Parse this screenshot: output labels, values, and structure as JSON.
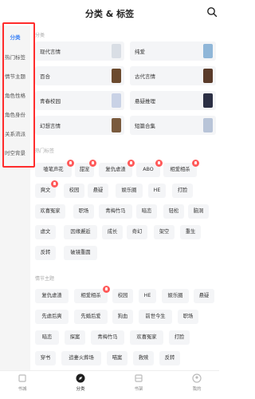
{
  "header": {
    "title": "分类 & 标签"
  },
  "sidebar": {
    "items": [
      "分类",
      "热门标签",
      "情节主题",
      "角色性格",
      "角色身份",
      "关系流派",
      "时空背景"
    ]
  },
  "sections": {
    "category": "分类",
    "hot_tags": "热门标签",
    "plot": "情节主题"
  },
  "categories": [
    "现代言情",
    "纯爱",
    "百合",
    "古代言情",
    "青春校园",
    "悬疑推理",
    "幻想言情",
    "短篇合集"
  ],
  "hot_tags": {
    "row1": [
      "嗑笔声花",
      "甜宠",
      "复仇虐渣",
      "ABO",
      "相爱相杀"
    ],
    "row2": [
      "爽文",
      "校园",
      "悬疑",
      "娱乐圈",
      "HE",
      "打脸"
    ],
    "row3": [
      "欢喜冤家",
      "职场",
      "青梅竹马",
      "暗恋",
      "轻松",
      "脑洞"
    ],
    "row4": [
      "虐文",
      "因缘邂逅",
      "成长",
      "奇幻",
      "架空",
      "重生"
    ],
    "row5": [
      "反转",
      "破镜重圆"
    ]
  },
  "plot_tags": {
    "row1": [
      "复仇虐渣",
      "相爱相杀",
      "校园",
      "HE",
      "娱乐圈",
      "悬疑"
    ],
    "row2": [
      "先虐后爽",
      "先婚后爱",
      "狗血",
      "前世今生",
      "职场"
    ],
    "row3": [
      "暗恋",
      "探案",
      "青梅竹马",
      "欢喜冤家",
      "打脸"
    ],
    "row4": [
      "穿书",
      "追妻火葬场",
      "喵案",
      "救赎",
      "反转"
    ]
  },
  "bottom_nav": [
    "书城",
    "分类",
    "书架",
    "我的"
  ]
}
